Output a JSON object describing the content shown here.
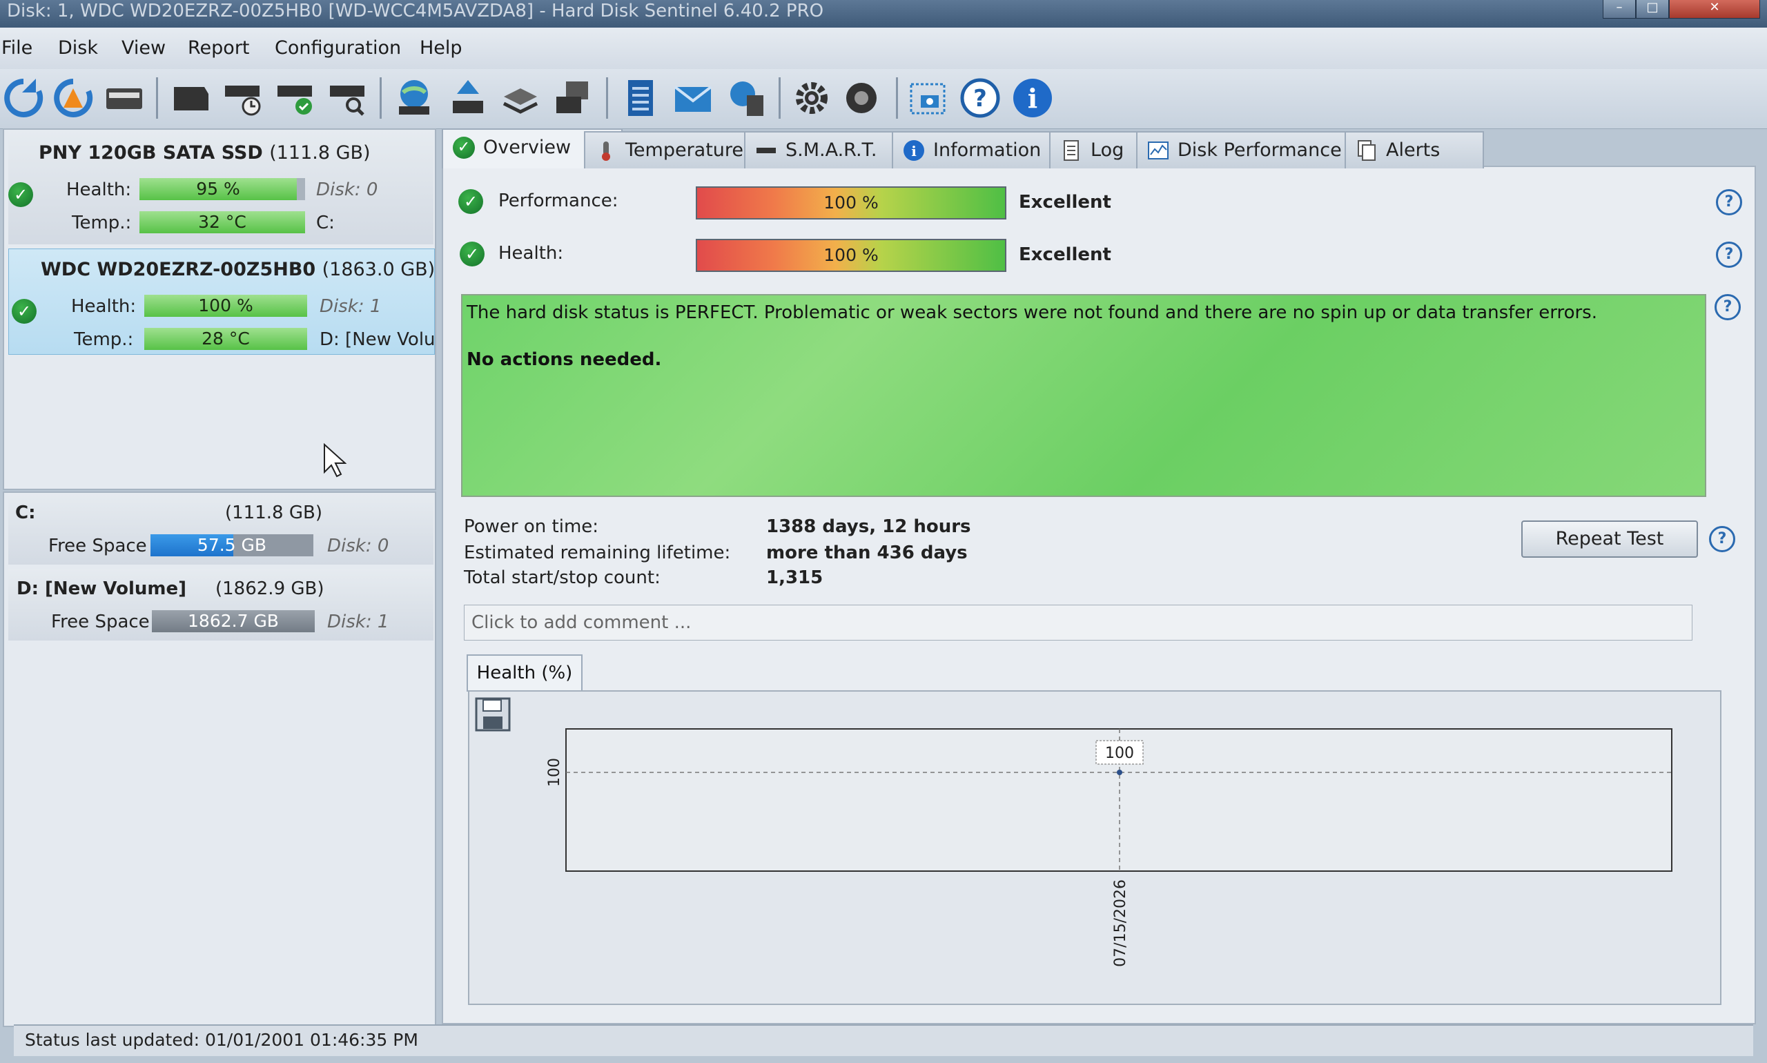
{
  "window": {
    "title": "Disk: 1, WDC WD20EZRZ-00Z5HB0 [WD-WCC4M5AVZDA8] - Hard Disk Sentinel 6.40.2 PRO"
  },
  "menu": [
    "File",
    "Disk",
    "View",
    "Report",
    "Configuration",
    "Help"
  ],
  "disks": [
    {
      "name": "PNY 120GB SATA SSD",
      "size": "(111.8 GB)",
      "health_label": "Health:",
      "health": "95 %",
      "health_pct": 95,
      "disk_label": "Disk: 0",
      "temp_label": "Temp.:",
      "temp": "32 °C",
      "volume_label": "C:"
    },
    {
      "name": "WDC WD20EZRZ-00Z5HB0",
      "size": "(1863.0 GB)",
      "health_label": "Health:",
      "health": "100 %",
      "health_pct": 100,
      "disk_label": "Disk: 1",
      "temp_label": "Temp.:",
      "temp": "28 °C",
      "volume_label": "D: [New Volu"
    }
  ],
  "volumes": [
    {
      "name": "C:",
      "size": "(111.8 GB)",
      "free_label": "Free Space",
      "free": "57.5 GB",
      "free_pct": 51,
      "disk_label": "Disk: 0"
    },
    {
      "name": "D: [New Volume]",
      "size": "(1862.9 GB)",
      "free_label": "Free Space",
      "free": "1862.7 GB",
      "free_pct": 100,
      "disk_label": "Disk: 1"
    }
  ],
  "tabs": [
    "Overview",
    "Temperature",
    "S.M.A.R.T.",
    "Information",
    "Log",
    "Disk Performance",
    "Alerts"
  ],
  "overview": {
    "performance_label": "Performance:",
    "performance_value": "100 %",
    "performance_rating": "Excellent",
    "health_label": "Health:",
    "health_value": "100 %",
    "health_rating": "Excellent",
    "status_text": "The hard disk status is PERFECT. Problematic or weak sectors were not found and there are no spin up or data transfer errors.",
    "action_text": "No actions needed.",
    "power_on_label": "Power on time:",
    "power_on_value": "1388 days, 12 hours",
    "lifetime_label": "Estimated remaining lifetime:",
    "lifetime_value": "more than 436 days",
    "startstop_label": "Total start/stop count:",
    "startstop_value": "1,315",
    "repeat_test": "Repeat Test",
    "comment_placeholder": "Click to add comment ..."
  },
  "health_chart_tab": "Health (%)",
  "chart_data": {
    "type": "line",
    "x": [
      "07/15/2026"
    ],
    "values": [
      100
    ],
    "ylabel": "",
    "xlabel": "",
    "y_tick": "100",
    "x_tick": "07/15/2026",
    "data_label": "100",
    "grid": true
  },
  "status_bar": "Status last updated: 01/01/2001 01:46:35 PM",
  "colors": {
    "health_green": "#57c247",
    "free_blue": "#1e73cc",
    "status_green": "#6fd36a"
  }
}
